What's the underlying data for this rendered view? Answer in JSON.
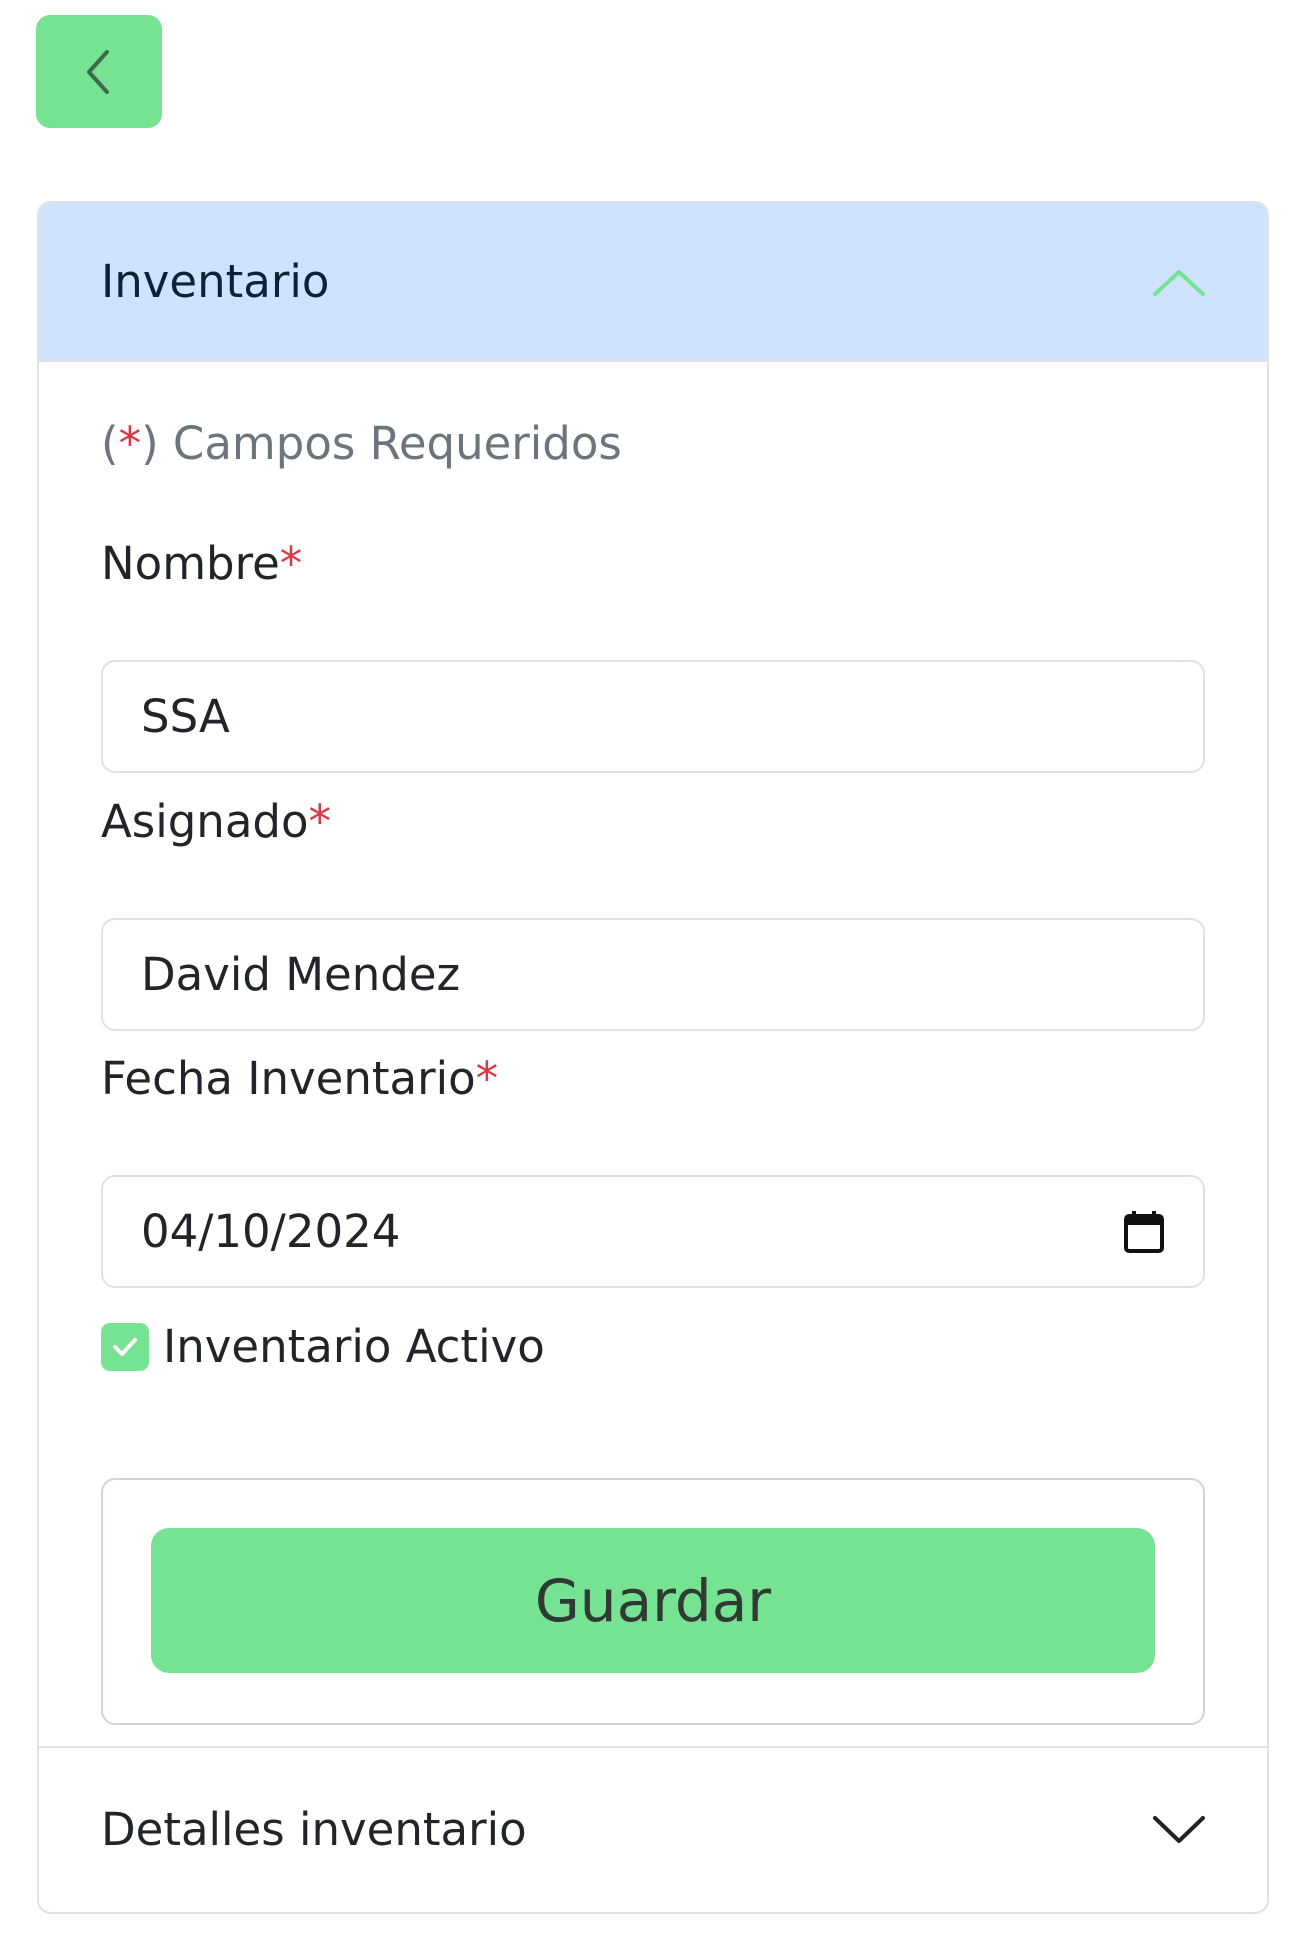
{
  "back_button": {
    "icon": "chevron-left-icon"
  },
  "section": {
    "title": "Inventario",
    "expanded": true,
    "toggle_icon": "chevron-up-icon",
    "accent_color": "#76e393",
    "header_bg": "#cfe2ff"
  },
  "form": {
    "required_prefix": "(",
    "required_star": "*",
    "required_suffix": ") Campos Requeridos",
    "fields": {
      "nombre": {
        "label": "Nombre",
        "star": "*",
        "value": "SSA"
      },
      "asignado": {
        "label": "Asignado",
        "star": "*",
        "value": "David Mendez"
      },
      "fecha": {
        "label": "Fecha Inventario",
        "star": "*",
        "value": "04/10/2024",
        "icon": "calendar-icon"
      }
    },
    "activo": {
      "label": "Inventario Activo",
      "checked": true
    },
    "save_label": "Guardar"
  },
  "details_section": {
    "title": "Detalles inventario",
    "expanded": false,
    "toggle_icon": "chevron-down-icon"
  }
}
